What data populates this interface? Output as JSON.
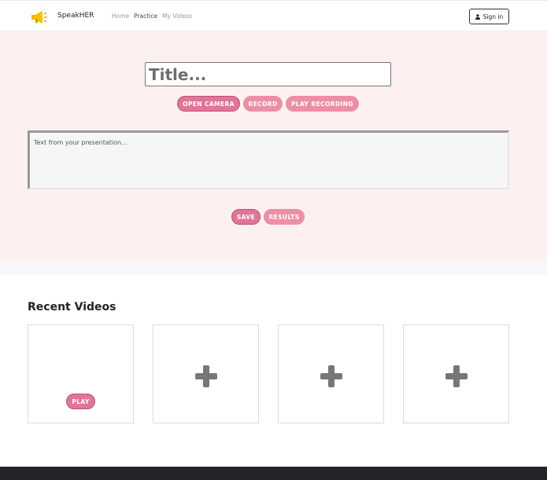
{
  "navbar": {
    "brand": "SpeakHER",
    "links": [
      {
        "label": "Home",
        "active": false
      },
      {
        "label": "Practice",
        "active": true
      },
      {
        "label": "My Videos",
        "active": false
      }
    ],
    "signin_label": "Sign in"
  },
  "practice": {
    "title_placeholder": "Title...",
    "buttons": {
      "open_camera": "OPEN CAMERA",
      "record": "RECORD",
      "play_recording": "PLAY RECORDING",
      "save": "SAVE",
      "results": "RESULTS"
    },
    "text_placeholder": "Text from your presentation..."
  },
  "recent": {
    "heading": "Recent Videos",
    "cards": [
      {
        "type": "video",
        "button": "PLAY"
      },
      {
        "type": "add",
        "icon": "plus-icon"
      },
      {
        "type": "add",
        "icon": "plus-icon"
      },
      {
        "type": "add",
        "icon": "plus-icon"
      }
    ]
  },
  "colors": {
    "accent_pink": "#e9849d",
    "accent_pink_dark": "#e07595",
    "hero_background": "#fcf1f0",
    "logo_yellow": "#f2b705",
    "footer": "#222428"
  }
}
